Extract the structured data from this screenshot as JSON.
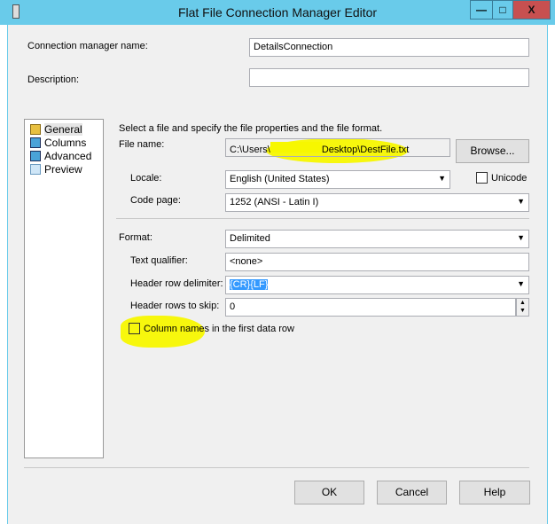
{
  "window": {
    "title": "Flat File Connection Manager Editor",
    "minimize": "—",
    "maximize": "□",
    "close": "X"
  },
  "connection_name": {
    "label": "Connection manager name:",
    "value": "DetailsConnection"
  },
  "description": {
    "label": "Description:",
    "value": ""
  },
  "nav": [
    {
      "label": "General"
    },
    {
      "label": "Columns"
    },
    {
      "label": "Advanced"
    },
    {
      "label": "Preview"
    }
  ],
  "general": {
    "intro": "Select a file and specify the file properties and the file format.",
    "file_name": {
      "label": "File name:",
      "value": "C:\\Users\\",
      "value_end": "Desktop\\DestFile.txt"
    },
    "browse": "Browse...",
    "locale": {
      "label": "Locale:",
      "value": "English (United States)"
    },
    "unicode": {
      "label": "Unicode",
      "checked": false
    },
    "code_page": {
      "label": "Code page:",
      "value": "1252  (ANSI - Latin I)"
    },
    "format": {
      "label": "Format:",
      "value": "Delimited"
    },
    "text_qualifier": {
      "label": "Text qualifier:",
      "value": "<none>"
    },
    "header_row_delimiter": {
      "label": "Header row delimiter:",
      "value": "{CR}{LF}"
    },
    "header_rows_to_skip": {
      "label": "Header rows to skip:",
      "value": "0"
    },
    "column_names": {
      "label": "Column names in the first data row",
      "checked": false
    }
  },
  "buttons": {
    "ok": "OK",
    "cancel": "Cancel",
    "help": "Help"
  },
  "colors": {
    "titlebar": "#69cbea",
    "close": "#c75050",
    "highlight": "#f7f700",
    "selection": "#3399ff"
  }
}
